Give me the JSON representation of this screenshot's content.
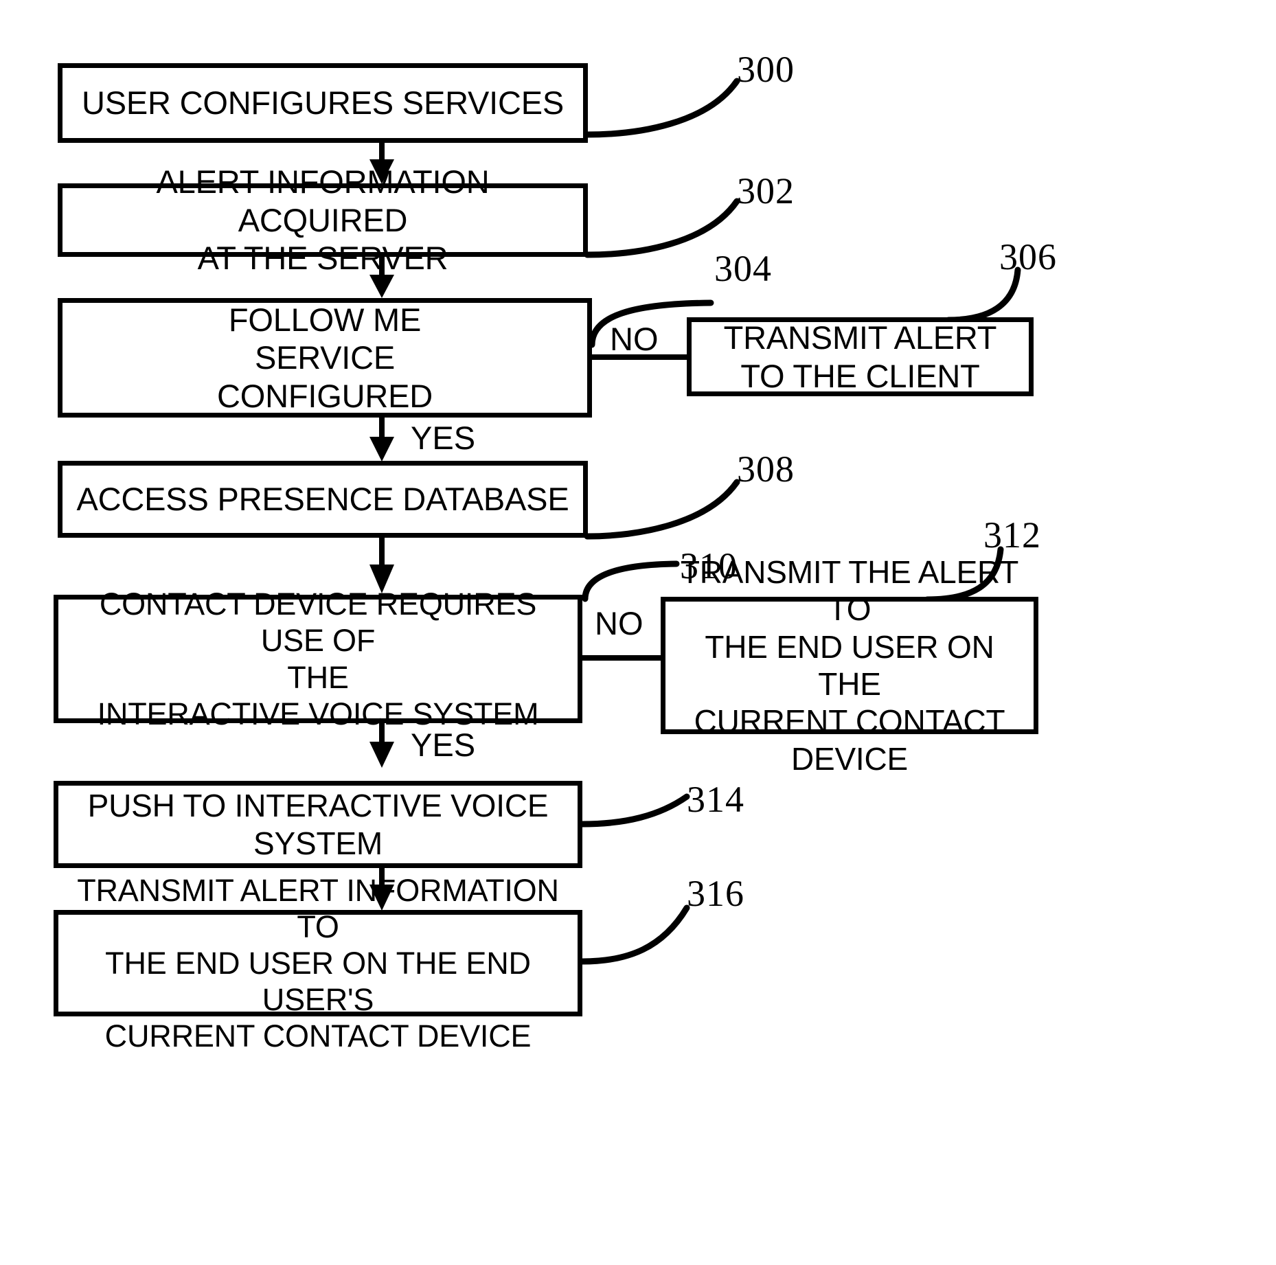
{
  "diagram": {
    "kind": "patent-flowchart",
    "line_color": "#000000",
    "background_color": "#ffffff"
  },
  "nodes": [
    {
      "id": "n300",
      "ref": "300",
      "text": "USER CONFIGURES SERVICES",
      "shape": "process"
    },
    {
      "id": "n302",
      "ref": "302",
      "text": "ALERT INFORMATION ACQUIRED\nAT THE SERVER",
      "shape": "process"
    },
    {
      "id": "n304",
      "ref": "304",
      "text": "FOLLOW ME\nSERVICE\nCONFIGURED",
      "shape": "decision"
    },
    {
      "id": "n306",
      "ref": "306",
      "text": "TRANSMIT ALERT\nTO THE CLIENT",
      "shape": "process"
    },
    {
      "id": "n308",
      "ref": "308",
      "text": "ACCESS PRESENCE DATABASE",
      "shape": "process"
    },
    {
      "id": "n310",
      "ref": "310",
      "text": "CONTACT DEVICE REQUIRES USE OF\nTHE\nINTERACTIVE VOICE SYSTEM",
      "shape": "decision"
    },
    {
      "id": "n312",
      "ref": "312",
      "text": "TRANSMIT THE ALERT TO\nTHE END USER ON THE\nCURRENT CONTACT\nDEVICE",
      "shape": "process"
    },
    {
      "id": "n314",
      "ref": "314",
      "text": "PUSH TO INTERACTIVE VOICE SYSTEM",
      "shape": "process"
    },
    {
      "id": "n316",
      "ref": "316",
      "text": "TRANSMIT ALERT INFORMATION TO\nTHE END USER ON THE END USER'S\nCURRENT CONTACT DEVICE",
      "shape": "process"
    }
  ],
  "edges": [
    {
      "id": "e1",
      "from": "n300",
      "to": "n302",
      "label": ""
    },
    {
      "id": "e2",
      "from": "n302",
      "to": "n304",
      "label": ""
    },
    {
      "id": "e3",
      "from": "n304",
      "to": "n306",
      "label": "NO"
    },
    {
      "id": "e4",
      "from": "n304",
      "to": "n308",
      "label": "YES"
    },
    {
      "id": "e5",
      "from": "n308",
      "to": "n310",
      "label": ""
    },
    {
      "id": "e6",
      "from": "n310",
      "to": "n312",
      "label": "NO"
    },
    {
      "id": "e7",
      "from": "n310",
      "to": "n314",
      "label": "YES"
    },
    {
      "id": "e8",
      "from": "n314",
      "to": "n316",
      "label": ""
    }
  ],
  "branch_labels": {
    "no_304": "NO",
    "yes_304": "YES",
    "no_310": "NO",
    "yes_310": "YES"
  },
  "ref_labels": {
    "r300": "300",
    "r302": "302",
    "r304": "304",
    "r306": "306",
    "r308": "308",
    "r310": "310",
    "r312": "312",
    "r314": "314",
    "r316": "316"
  }
}
